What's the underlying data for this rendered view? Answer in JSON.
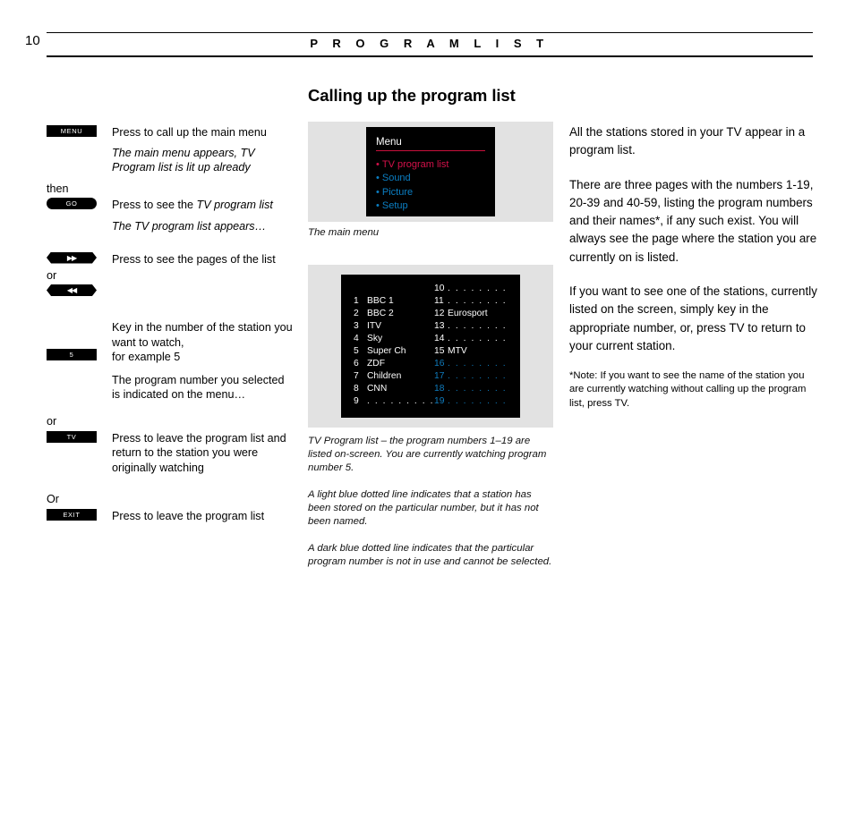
{
  "header": {
    "page_number": "10",
    "title": "P R O G R A M   L I S T"
  },
  "section": {
    "title": "Calling up the program list"
  },
  "steps": [
    {
      "key_label": "MENU",
      "key_shape": "rect",
      "description": "Press to call up the main menu"
    },
    {
      "key_label": "",
      "key_shape": "none",
      "description": "The main menu appears, TV Program list is lit up already"
    },
    {
      "conjunction": "then",
      "key_label": "GO",
      "key_shape": "pill",
      "description": "Press to see the TV program list"
    },
    {
      "key_label": "",
      "key_shape": "none",
      "description": "The TV program list appears…"
    },
    {
      "key_label": "forward-icon",
      "key_shape": "hex",
      "key_glyph": "▶▶",
      "description": "Press to see the pages of the list"
    },
    {
      "conjunction": "or",
      "key_label": "rewind-icon",
      "key_shape": "hex",
      "key_glyph": "◀◀",
      "description": ""
    },
    {
      "key_label": "5",
      "key_shape": "rect",
      "description": "Key in the number of the station you want to watch, for example 5"
    },
    {
      "key_label": "",
      "key_shape": "none",
      "description": "The program number you selected is indicated on the menu…"
    },
    {
      "conjunction": "or",
      "key_label": "TV",
      "key_shape": "rect",
      "description": "Press to leave the program list and return to the station you were originally watching"
    },
    {
      "conjunction": "Or",
      "key_label": "EXIT",
      "key_shape": "rect",
      "description": "Press to leave the program list"
    }
  ],
  "step_text": {
    "s1_desc": "Press to call up the main menu",
    "s2_desc": "The main menu appears, TV Program list is lit up already",
    "s3_conj": "then",
    "s3_desc_a": "Press to see the ",
    "s3_desc_b": "TV program list",
    "s4_desc": "The TV program list appears…",
    "s5_desc": "Press to see the pages of the list",
    "s6_conj": "or",
    "s7_desc_l1": "Key in the number of the station you",
    "s7_desc_l2": "want to watch,",
    "s7_desc_l3": "for example 5",
    "s8_desc": "The program number you selected is indicated on the menu…",
    "s9_conj": "or",
    "s9_desc": "Press to leave the program list and return to the station you were originally watching",
    "s10_conj": "Or",
    "s10_desc": "Press to leave the program list"
  },
  "keys": {
    "menu": "MENU",
    "go": "GO",
    "forward_glyph": "▶▶",
    "rewind_glyph": "◀◀",
    "five": "5",
    "tv": "TV",
    "exit": "EXIT"
  },
  "tv_menu": {
    "title": "Menu",
    "items": [
      {
        "label": "TV program list",
        "color": "#d4114a",
        "state": "highlighted"
      },
      {
        "label": "Sound",
        "color": "#0b7fc4",
        "state": "normal"
      },
      {
        "label": "Picture",
        "color": "#0b7fc4",
        "state": "normal"
      },
      {
        "label": "Setup",
        "color": "#0b7fc4",
        "state": "normal"
      }
    ],
    "bullet": "•",
    "rule_color": "#c8103c",
    "caption": "The main menu"
  },
  "tv_program_list": {
    "left_column": [
      {
        "num": "",
        "name": "",
        "style": "blank"
      },
      {
        "num": "1",
        "name": "BBC 1",
        "style": "named"
      },
      {
        "num": "2",
        "name": "BBC 2",
        "style": "named"
      },
      {
        "num": "3",
        "name": "ITV",
        "style": "named"
      },
      {
        "num": "4",
        "name": "Sky",
        "style": "named"
      },
      {
        "num": "5",
        "name": "Super Ch",
        "style": "named"
      },
      {
        "num": "6",
        "name": "ZDF",
        "style": "named"
      },
      {
        "num": "7",
        "name": "Children",
        "style": "named"
      },
      {
        "num": "8",
        "name": "CNN",
        "style": "named"
      },
      {
        "num": "9",
        "name": ". . . . . . . . .",
        "style": "light-dotted"
      }
    ],
    "right_column": [
      {
        "num": "10",
        "name": ". . . . . . . .",
        "style": "light-dotted"
      },
      {
        "num": "11",
        "name": ". . . . . . . .",
        "style": "light-dotted"
      },
      {
        "num": "12",
        "name": "Eurosport",
        "style": "named"
      },
      {
        "num": "13",
        "name": ". . . . . . . .",
        "style": "light-dotted"
      },
      {
        "num": "14",
        "name": ". . . . . . . .",
        "style": "light-dotted"
      },
      {
        "num": "15",
        "name": "MTV",
        "style": "named"
      },
      {
        "num": "16",
        "name": ". . . . . . . .",
        "style": "dark-dotted"
      },
      {
        "num": "17",
        "name": ". . . . . . . .",
        "style": "dark-dotted"
      },
      {
        "num": "18",
        "name": ". . . . . . . .",
        "style": "dark-dotted"
      },
      {
        "num": "19",
        "name": ". . . . . . . .",
        "style": "dark-dotted"
      }
    ],
    "caption_1": "TV Program list – the program numbers 1–19 are listed on-screen. You are currently watching program number 5.",
    "caption_2": "A light blue dotted line indicates that a station has been stored on the particular number, but it has not been named.",
    "caption_3": "A dark blue dotted line indicates that the particular program number is not in use and cannot be selected."
  },
  "body": {
    "para_1": "All the stations stored in your TV appear in a program list.",
    "para_2": "There are three pages with the numbers 1-19, 20-39 and 40-59, listing the program numbers  and their names*, if any such exist. You will always see the page where the station you are currently on is listed.",
    "para_3": "If you want to see one of the stations, currently listed on the screen, simply key in the appropriate number, or, press TV to return to your current station.",
    "note": "*Note: If you want to see the name of the station you are currently watching without calling up the program list, press TV."
  },
  "colors": {
    "highlight_red": "#d4114a",
    "menu_blue": "#0b7fc4",
    "dark_dotted_blue": "#0f7bbd",
    "rule_red": "#c8103c",
    "screen_bg": "#000000",
    "frame_bg": "#e2e2e2"
  }
}
